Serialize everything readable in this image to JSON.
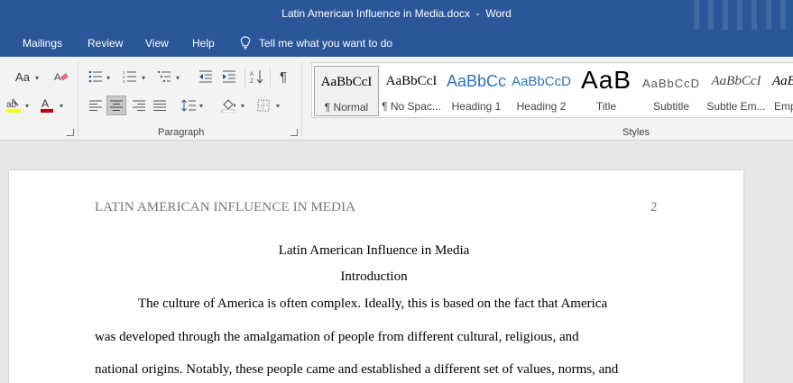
{
  "window": {
    "doc_title": "Latin American Influence in Media.docx",
    "separator": "-",
    "app": "Word"
  },
  "tabs": [
    "Mailings",
    "Review",
    "View",
    "Help"
  ],
  "tell_me": "Tell me what you want to do",
  "ribbon": {
    "font_group_icons": [
      "change-case-icon",
      "clear-formatting-icon",
      "highlight-icon",
      "font-color-icon"
    ],
    "change_case_label": "Aa",
    "paragraph_label": "Paragraph",
    "styles_label": "Styles",
    "highlight_color": "#ffff00",
    "font_color": "#c00000",
    "styles": [
      {
        "sample": "AaBbCcI",
        "name": "¶ Normal"
      },
      {
        "sample": "AaBbCcI",
        "name": "¶ No Spac..."
      },
      {
        "sample": "AaBbCc",
        "name": "Heading 1"
      },
      {
        "sample": "AaBbCcD",
        "name": "Heading 2"
      },
      {
        "sample": "AaB",
        "name": "Title"
      },
      {
        "sample": "AaBbCcD",
        "name": "Subtitle"
      },
      {
        "sample": "AaBbCcI",
        "name": "Subtle Em..."
      },
      {
        "sample": "AaB",
        "name": "Emp"
      }
    ]
  },
  "document": {
    "running_head": "LATIN AMERICAN INFLUENCE IN MEDIA",
    "page_number": "2",
    "title": "Latin American Influence in Media",
    "section": "Introduction",
    "lines": [
      "The culture of America is often complex. Ideally, this is based on the fact that America",
      "was developed through the amalgamation of people from different cultural, religious, and",
      "national origins. Notably, these people came and established a different set of values, norms, and"
    ]
  }
}
